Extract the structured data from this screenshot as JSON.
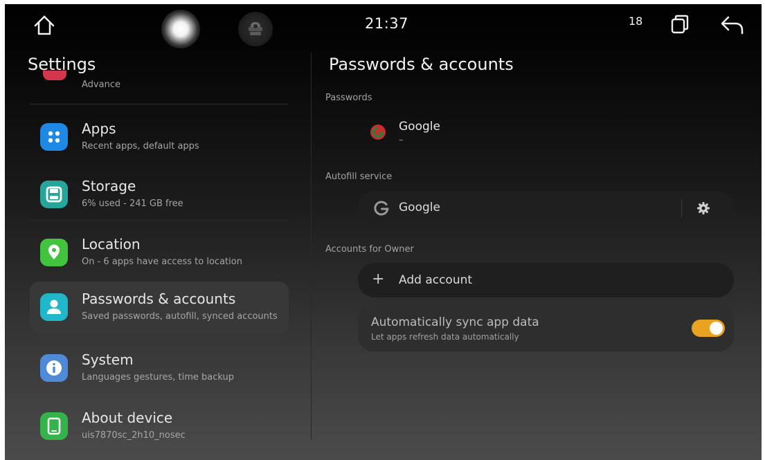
{
  "status_bar": {
    "home_icon": "home-outline-icon",
    "assistant_orb": "assistant-orb-icon",
    "voice_icon": "voice-assistant-icon",
    "time": "21:37",
    "notification_count": "18",
    "recents_icon": "recent-apps-icon",
    "back_icon": "back-arrow-icon"
  },
  "left_panel": {
    "title": "Settings",
    "partial_item_sub": "Advance",
    "items": [
      {
        "title": "Apps",
        "subtitle": "Recent apps, default apps",
        "icon": "apps-grid-icon",
        "color": "#1e88e5",
        "active": false
      },
      {
        "title": "Storage",
        "subtitle": "6% used - 241 GB free",
        "icon": "storage-icon",
        "color": "#26a69a",
        "active": false
      },
      {
        "title": "Location",
        "subtitle": "On - 6 apps have access to location",
        "icon": "location-pin-icon",
        "color": "#43c43f",
        "active": false
      },
      {
        "title": "Passwords & accounts",
        "subtitle": "Saved passwords, autofill, synced accounts",
        "icon": "account-person-icon",
        "color": "#1fb7c9",
        "active": true
      },
      {
        "title": "System",
        "subtitle": "Languages  gestures, time  backup",
        "icon": "info-icon",
        "color": "#4f8ad8",
        "active": false
      },
      {
        "title": "About device",
        "subtitle": "uis7870sc_2h10_nosec",
        "icon": "tablet-device-icon",
        "color": "#33b34a",
        "active": false
      }
    ]
  },
  "right_panel": {
    "title": "Passwords & accounts",
    "passwords_section": {
      "label": "Passwords",
      "entry": {
        "name": "Google",
        "sub": "–",
        "icon": "google-g-icon"
      }
    },
    "autofill_section": {
      "label": "Autofill service",
      "service_name": "Google",
      "service_icon": "google-g-icon",
      "settings_icon": "gear-icon"
    },
    "accounts_section": {
      "label": "Accounts for Owner",
      "add_label": "Add account",
      "add_icon": "plus-icon",
      "plus_glyph": "+"
    },
    "sync": {
      "title": "Automatically sync app data",
      "subtitle": "Let apps refresh data automatically",
      "enabled": true,
      "toggle_color": "#e9a321"
    }
  }
}
